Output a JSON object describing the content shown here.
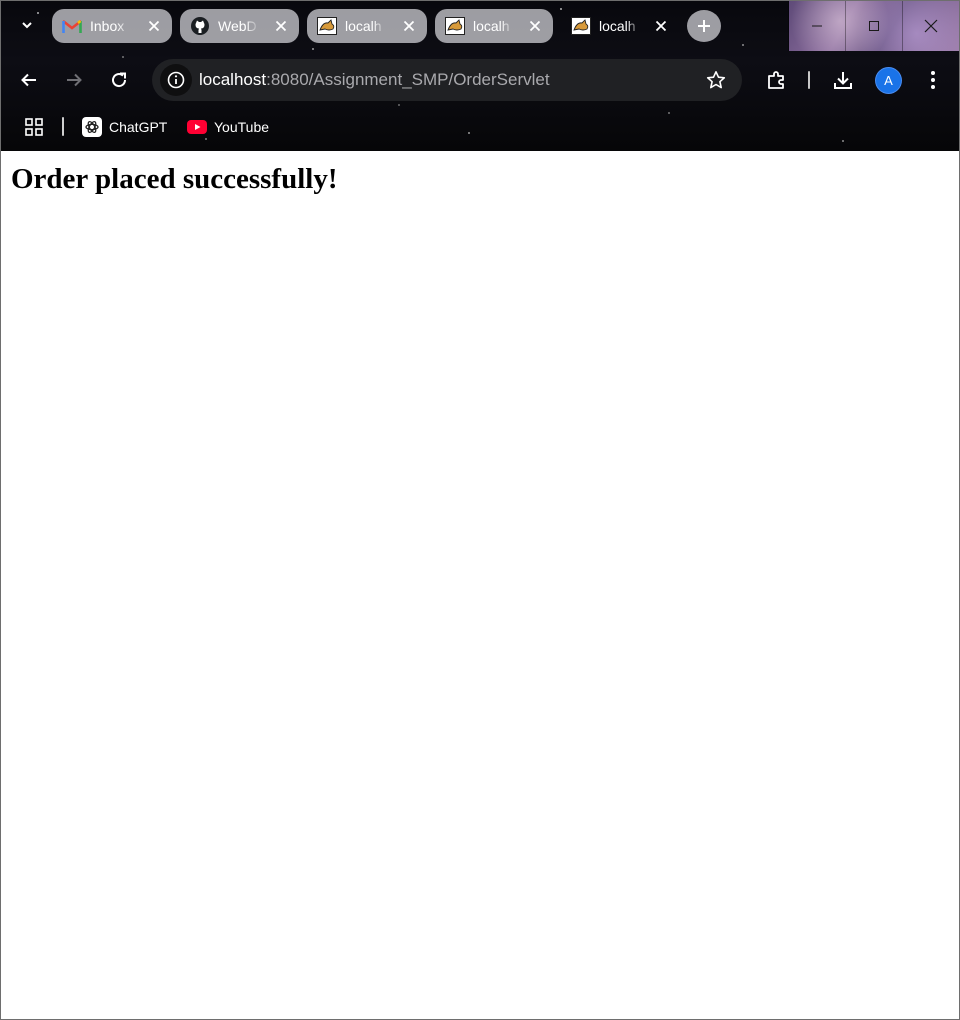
{
  "browser": {
    "tabs": [
      {
        "title": "Inbox",
        "favicon": "gmail-icon",
        "active": false
      },
      {
        "title": "WebD",
        "favicon": "github-icon",
        "active": false
      },
      {
        "title": "localh",
        "favicon": "tomcat-icon",
        "active": false
      },
      {
        "title": "localh",
        "favicon": "tomcat-icon",
        "active": false
      },
      {
        "title": "localh",
        "favicon": "tomcat-icon",
        "active": true
      }
    ],
    "address": {
      "host": "localhost",
      "rest": ":8080/Assignment_SMP/OrderServlet"
    },
    "profile_initial": "A",
    "bookmarks": [
      {
        "label": "ChatGPT",
        "icon": "chatgpt-icon"
      },
      {
        "label": "YouTube",
        "icon": "youtube-icon"
      }
    ]
  },
  "page": {
    "heading": "Order placed successfully!"
  },
  "colors": {
    "accent_avatar": "#1a73e8",
    "youtube_red": "#ff0033",
    "omnibox_bg": "#202124"
  }
}
